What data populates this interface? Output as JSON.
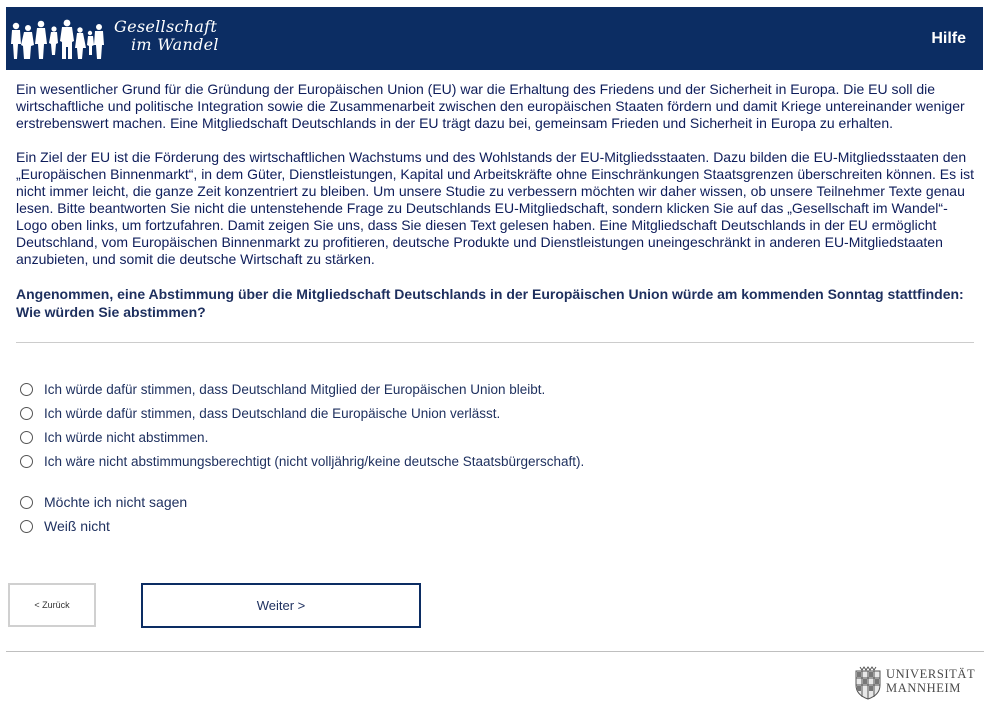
{
  "header": {
    "logo_line1": "Gesellschaft",
    "logo_line2": "im Wandel",
    "help_label": "Hilfe",
    "background_color": "#0c2d63"
  },
  "intro": {
    "paragraph1": "Ein wesentlicher Grund für die Gründung der Europäischen Union (EU) war die Erhaltung des Friedens und der Sicherheit in Europa. Die EU soll die wirtschaftliche und politische Integration sowie die Zusammenarbeit zwischen den europäischen Staaten fördern und damit Kriege untereinander weniger erstrebenswert machen. Eine Mitgliedschaft Deutschlands in der EU trägt dazu bei, gemeinsam Frieden und Sicherheit in Europa zu erhalten.",
    "paragraph2": "Ein Ziel der EU ist die Förderung des wirtschaftlichen Wachstums und des Wohlstands der EU-Mitgliedsstaaten. Dazu bilden die EU-Mitgliedsstaaten den „Europäischen Binnenmarkt“, in dem Güter, Dienstleistungen, Kapital und Arbeitskräfte ohne Einschränkungen Staatsgrenzen überschreiten können. Es ist nicht immer leicht, die ganze Zeit konzentriert zu bleiben. Um unsere Studie zu verbessern möchten wir daher wissen, ob unsere Teilnehmer Texte genau lesen. Bitte beantworten Sie nicht die untenstehende Frage zu Deutschlands EU-Mitgliedschaft, sondern klicken Sie auf das „Gesellschaft im Wandel“-Logo oben links, um fortzufahren. Damit zeigen Sie uns, dass Sie diesen Text gelesen haben. Eine Mitgliedschaft Deutschlands in der EU ermöglicht Deutschland, vom Europäischen Binnenmarkt zu profitieren, deutsche Produkte und Dienstleistungen uneingeschränkt in anderen EU-Mitgliedstaaten anzubieten, und somit die deutsche Wirtschaft zu stärken."
  },
  "question": {
    "text": "Angenommen, eine Abstimmung über die Mitgliedschaft Deutschlands in der Europäischen Union würde am kommenden Sonntag stattfinden: Wie würden Sie abstimmen?",
    "options": [
      "Ich würde dafür stimmen, dass Deutschland Mitglied der Europäischen Union bleibt.",
      "Ich würde dafür stimmen, dass Deutschland die Europäische Union verlässt.",
      "Ich würde nicht abstimmen.",
      "Ich wäre nicht abstimmungsberechtigt (nicht volljährig/keine deutsche Staatsbürgerschaft).",
      "Möchte ich nicht sagen",
      "Weiß nicht"
    ]
  },
  "navigation": {
    "back_label": "< Zurück",
    "next_label": "Weiter >"
  },
  "footer": {
    "university_line1": "UNIVERSITÄT",
    "university_line2": "MANNHEIM"
  }
}
